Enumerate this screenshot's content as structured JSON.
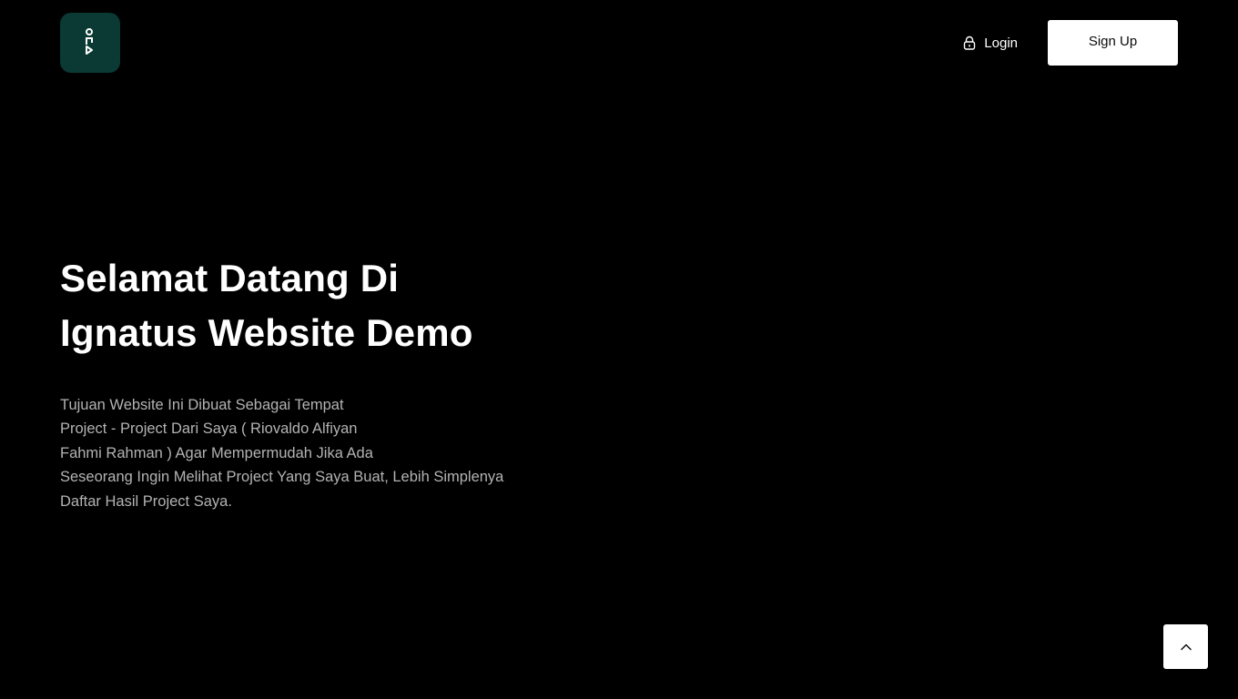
{
  "header": {
    "logo_icon": "ignatus-logo-icon",
    "logo_color": "#0a3a33",
    "login_icon": "lock-icon",
    "login_label": "Login",
    "signup_label": "Sign Up"
  },
  "hero": {
    "title_line1": "Selamat Datang Di",
    "title_line2": "Ignatus Website Demo",
    "description_lines": [
      "Tujuan Website Ini Dibuat Sebagai Tempat",
      "Project - Project Dari Saya ( Riovaldo Alfiyan",
      "Fahmi Rahman ) Agar Mempermudah Jika Ada",
      "Seseorang Ingin Melihat Project Yang Saya Buat, Lebih Simplenya",
      "Daftar Hasil Project Saya."
    ]
  },
  "scroll_top": {
    "icon": "chevron-up-icon"
  }
}
